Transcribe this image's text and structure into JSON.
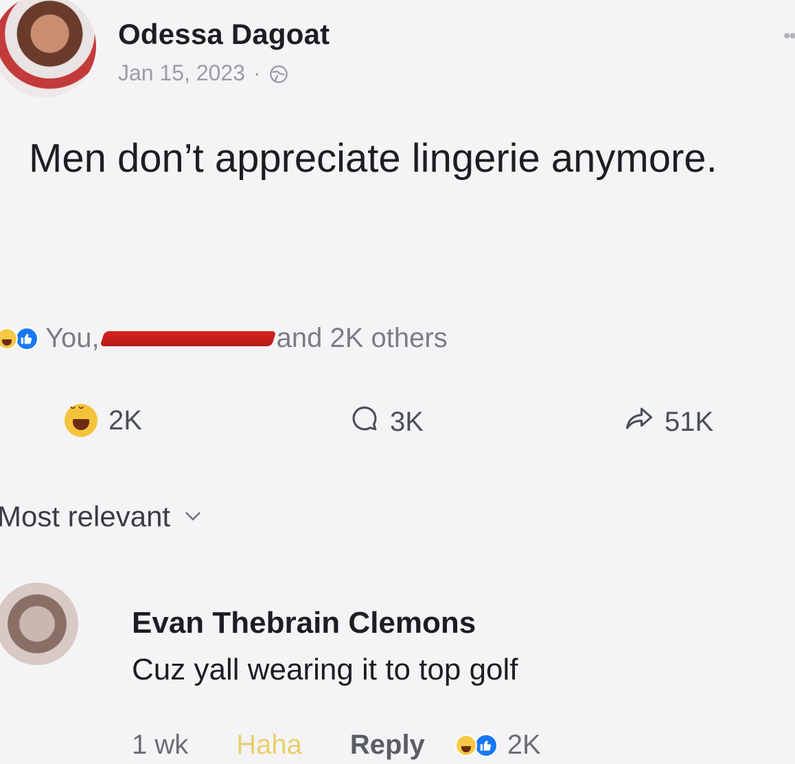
{
  "post": {
    "author": "Odessa Dagoat",
    "date": "Jan 15, 2023",
    "separator": "·",
    "text": "Men don’t appreciate lingerie anymore.",
    "reactions_prefix": "You,",
    "reactions_suffix": "and 2K others",
    "counts": {
      "haha": "2K",
      "comments": "3K",
      "shares": "51K"
    }
  },
  "sort": {
    "label": "Most relevant"
  },
  "comment": {
    "author": "Evan Thebrain Clemons",
    "text": "Cuz yall wearing it to top golf",
    "time": "1 wk",
    "haha_label": "Haha",
    "reply_label": "Reply",
    "reaction_count": "2K"
  },
  "icons": {
    "globe": "globe-icon",
    "more": "more-icon",
    "comment": "comment-icon",
    "share": "share-icon",
    "chevron": "chevron-down-icon",
    "like": "like-icon",
    "haha": "haha-icon"
  },
  "colors": {
    "like_blue": "#1877f2",
    "haha_yellow": "#f5c33b",
    "redaction": "#d6241f"
  }
}
